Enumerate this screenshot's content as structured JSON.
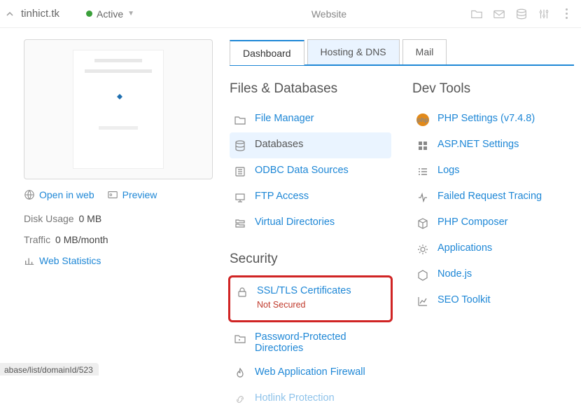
{
  "topbar": {
    "domain": "tinhict.tk",
    "status": "Active",
    "center_label": "Website"
  },
  "left": {
    "open_in_web": "Open in web",
    "preview": "Preview",
    "disk_usage_label": "Disk Usage",
    "disk_usage_value": "0 MB",
    "traffic_label": "Traffic",
    "traffic_value": "0 MB/month",
    "web_stats": "Web Statistics"
  },
  "tabs": {
    "dashboard": "Dashboard",
    "hosting": "Hosting & DNS",
    "mail": "Mail"
  },
  "sections": {
    "files_db": "Files & Databases",
    "security": "Security",
    "dev_tools": "Dev Tools"
  },
  "items": {
    "file_manager": "File Manager",
    "databases": "Databases",
    "odbc": "ODBC Data Sources",
    "ftp": "FTP Access",
    "virtual_dirs": "Virtual Directories",
    "ssl": "SSL/TLS Certificates",
    "ssl_status": "Not Secured",
    "pass_prot": "Password-Protected Directories",
    "waf": "Web Application Firewall",
    "hotlink": "Hotlink Protection",
    "php": "PHP Settings (v7.4.8)",
    "asp": "ASP.NET Settings",
    "logs": "Logs",
    "failed_trace": "Failed Request Tracing",
    "composer": "PHP Composer",
    "applications": "Applications",
    "nodejs": "Node.js",
    "seo": "SEO Toolkit"
  },
  "status_url": "abase/list/domainId/523"
}
